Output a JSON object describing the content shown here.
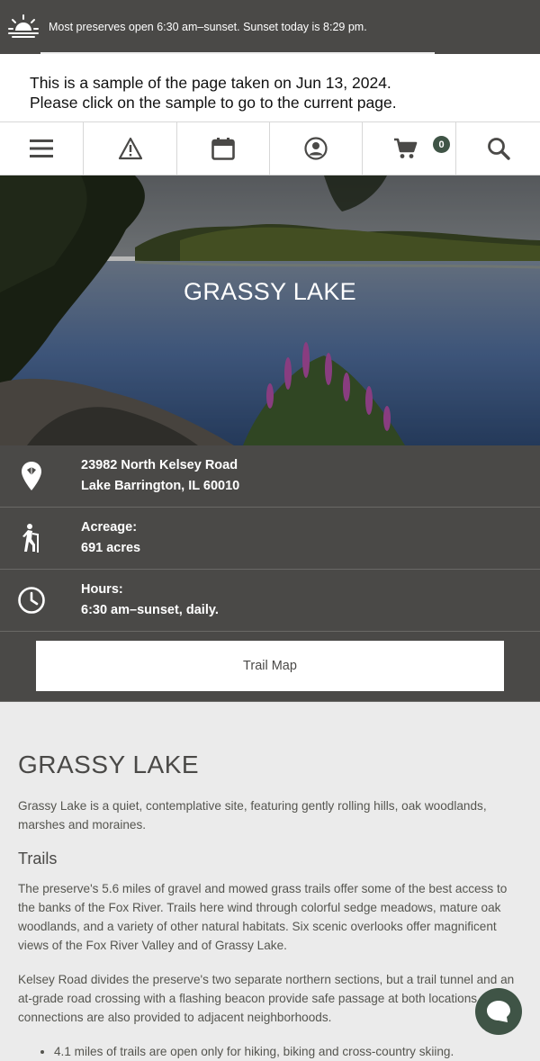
{
  "topbar": {
    "message": "Most preserves open 6:30 am–sunset. Sunset today is 8:29 pm.",
    "icon": "sunset-icon"
  },
  "notice": {
    "line1": "This is a sample of the page taken on Jun 13, 2024.",
    "line2": "Please click on the sample to go to the current page."
  },
  "nav": {
    "items": [
      "menu-icon",
      "alert-icon",
      "calendar-icon",
      "account-icon",
      "cart-icon",
      "search-icon"
    ],
    "cart_count": "0"
  },
  "hero": {
    "title": "GRASSY LAKE"
  },
  "info": {
    "address_line1": "23982 North Kelsey Road",
    "address_line2": "Lake Barrington, IL 60010",
    "acreage_label": "Acreage:",
    "acreage_value": "691 acres",
    "hours_label": "Hours:",
    "hours_value": "6:30 am–sunset, daily.",
    "trail_map_label": "Trail Map"
  },
  "content": {
    "title": "GRASSY LAKE",
    "intro": "Grassy Lake is a quiet, contemplative site, featuring gently rolling hills, oak woodlands, marshes and moraines.",
    "trails_heading": "Trails",
    "trails_p1": "The preserve's 5.6 miles of gravel and mowed grass trails offer some of the best access to the banks of the Fox River. Trails here wind through colorful sedge meadows, mature oak woodlands, and a variety of other natural habitats. Six scenic overlooks offer magnificent views of the Fox River Valley and of Grassy Lake.",
    "trails_p2": "Kelsey Road divides the preserve's two separate northern sections, but a trail tunnel and an at-grade road crossing with a flashing beacon provide safe passage at both locations. Trail connections are also provided to adjacent neighborhoods.",
    "bullet1": "4.1 miles of trails are open only for hiking, biking and cross-country skiing."
  },
  "colors": {
    "dark_bar": "#4a4947",
    "accent_green": "#3f5446",
    "content_bg": "#ebebeb"
  }
}
